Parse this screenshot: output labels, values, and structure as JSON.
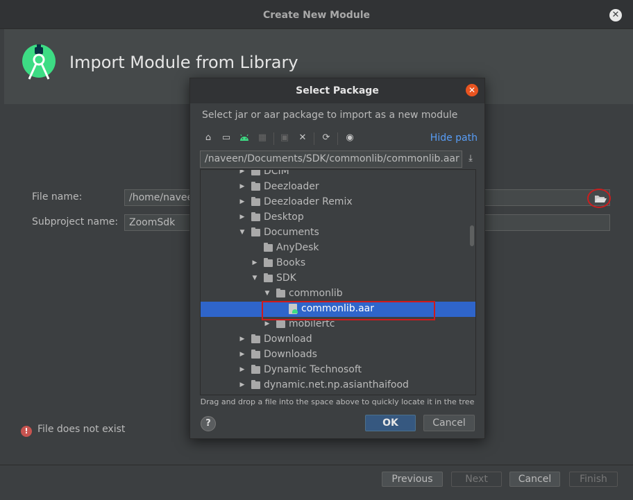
{
  "outer_window": {
    "title": "Create New Module",
    "heading": "Import Module from Library",
    "file_name_label": "File name:",
    "file_name_value": "/home/naveen/Documents/SDK/commonlib/commonlib.aar",
    "subproject_label": "Subproject name:",
    "subproject_value": "ZoomSdk",
    "error_text": "File does not exist",
    "buttons": {
      "previous": "Previous",
      "next": "Next",
      "cancel": "Cancel",
      "finish": "Finish"
    }
  },
  "dialog": {
    "title": "Select Package",
    "description": "Select jar or aar package to import as a new module",
    "hide_path": "Hide path",
    "path_value": "/naveen/Documents/SDK/commonlib/commonlib.aar",
    "toolbar_icons": [
      "home-icon",
      "desktop-icon",
      "android-icon",
      "module-icon",
      "new-folder-icon",
      "delete-icon",
      "refresh-icon",
      "show-hidden-icon"
    ],
    "tree": [
      {
        "label": "DCIM",
        "level": 0,
        "expanded": false,
        "type": "folder"
      },
      {
        "label": "Deezloader",
        "level": 0,
        "expanded": false,
        "type": "folder"
      },
      {
        "label": "Deezloader Remix",
        "level": 0,
        "expanded": false,
        "type": "folder"
      },
      {
        "label": "Desktop",
        "level": 0,
        "expanded": false,
        "type": "folder"
      },
      {
        "label": "Documents",
        "level": 0,
        "expanded": true,
        "type": "folder"
      },
      {
        "label": "AnyDesk",
        "level": 1,
        "expanded": null,
        "type": "folder"
      },
      {
        "label": "Books",
        "level": 1,
        "expanded": false,
        "type": "folder"
      },
      {
        "label": "SDK",
        "level": 1,
        "expanded": true,
        "type": "folder"
      },
      {
        "label": "commonlib",
        "level": 2,
        "expanded": true,
        "type": "folder"
      },
      {
        "label": "commonlib.aar",
        "level": 3,
        "expanded": null,
        "type": "file",
        "selected": true
      },
      {
        "label": "mobilertc",
        "level": 2,
        "expanded": false,
        "type": "folder"
      },
      {
        "label": "Download",
        "level": 0,
        "expanded": false,
        "type": "folder"
      },
      {
        "label": "Downloads",
        "level": 0,
        "expanded": false,
        "type": "folder"
      },
      {
        "label": "Dynamic Technosoft",
        "level": 0,
        "expanded": false,
        "type": "folder"
      },
      {
        "label": "dynamic.net.np.asianthaifood",
        "level": 0,
        "expanded": false,
        "type": "folder"
      }
    ],
    "dnd_hint": "Drag and drop a file into the space above to quickly locate it in the tree",
    "help_label": "?",
    "ok_label": "OK",
    "cancel_label": "Cancel"
  },
  "colors": {
    "background": "#3c3f41",
    "selection": "#2f65ca",
    "accent_link": "#589df6",
    "close_orange": "#e95420",
    "highlight_red": "#d01a1a",
    "android_green": "#3ddc84"
  }
}
